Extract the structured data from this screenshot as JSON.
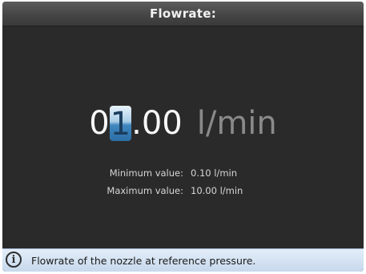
{
  "dialog": {
    "title": "Flowrate:"
  },
  "value": {
    "digits": [
      "0",
      "1"
    ],
    "decimal_separator": ".",
    "decimals": [
      "0",
      "0"
    ],
    "selected_digit_index": 1,
    "unit": "l/min"
  },
  "limits": {
    "minimum_label": "Minimum value:",
    "minimum_value": "0.10 l/min",
    "maximum_label": "Maximum value:",
    "maximum_value": "10.00 l/min"
  },
  "info": {
    "icon": "info-icon",
    "text": "Flowrate of the nozzle at reference pressure."
  },
  "colors": {
    "background": "#2b2a2a",
    "selection_accent": "#3f86bf",
    "info_bar": "#d4e3f3"
  }
}
